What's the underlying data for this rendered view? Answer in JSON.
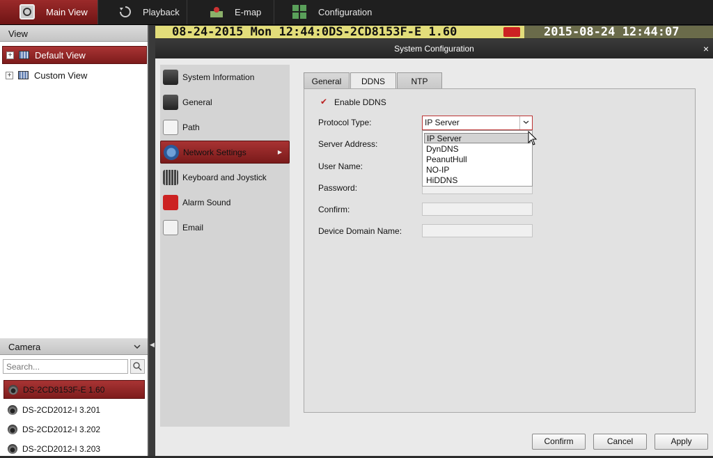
{
  "topbar": {
    "tabs": [
      {
        "label": "Main View",
        "icon": "monitor-icon",
        "active": true
      },
      {
        "label": "Playback",
        "icon": "playback-icon",
        "active": false
      },
      {
        "label": "E-map",
        "icon": "map-icon",
        "active": false
      },
      {
        "label": "Configuration",
        "icon": "grid-icon",
        "active": false
      }
    ]
  },
  "left": {
    "view_header": "View",
    "views": [
      {
        "label": "Default View",
        "selected": true
      },
      {
        "label": "Custom View",
        "selected": false
      }
    ],
    "camera_header": "Camera",
    "search_placeholder": "Search...",
    "cameras": [
      {
        "label": "DS-2CD8153F-E 1.60",
        "selected": true
      },
      {
        "label": "DS-2CD2012-I 3.201",
        "selected": false
      },
      {
        "label": "DS-2CD2012-I 3.202",
        "selected": false
      },
      {
        "label": "DS-2CD2012-I 3.203",
        "selected": false
      }
    ]
  },
  "osd": {
    "left": "08-24-2015 Mon 12:44:0DS-2CD8153F-E 1.60",
    "right": "2015-08-24 12:44:07"
  },
  "dialog": {
    "title": "System Configuration",
    "close": "×",
    "nav": [
      {
        "label": "System Information",
        "icon": "system-info-icon"
      },
      {
        "label": "General",
        "icon": "general-icon"
      },
      {
        "label": "Path",
        "icon": "path-icon"
      },
      {
        "label": "Network Settings",
        "icon": "network-icon",
        "selected": true
      },
      {
        "label": "Keyboard and Joystick",
        "icon": "keyboard-icon"
      },
      {
        "label": "Alarm Sound",
        "icon": "alarm-sound-icon"
      },
      {
        "label": "Email",
        "icon": "email-icon"
      }
    ],
    "tabs": [
      "General",
      "DDNS",
      "NTP"
    ],
    "active_tab": "DDNS",
    "enable_ddns": {
      "label": "Enable DDNS",
      "checked": true
    },
    "fields": {
      "protocol_type": "Protocol Type:",
      "server_address": "Server Address:",
      "user_name": "User Name:",
      "password": "Password:",
      "confirm": "Confirm:",
      "device_domain": "Device Domain Name:"
    },
    "protocol_value": "IP Server",
    "protocol_options": [
      "IP Server",
      "DynDNS",
      "PeanutHull",
      "NO-IP",
      "HiDDNS"
    ],
    "buttons": {
      "confirm": "Confirm",
      "cancel": "Cancel",
      "apply": "Apply"
    }
  },
  "colors": {
    "accent": "#8e2323",
    "topbar": "#1f1f1f",
    "osd_bg": "#e2dd7a"
  }
}
